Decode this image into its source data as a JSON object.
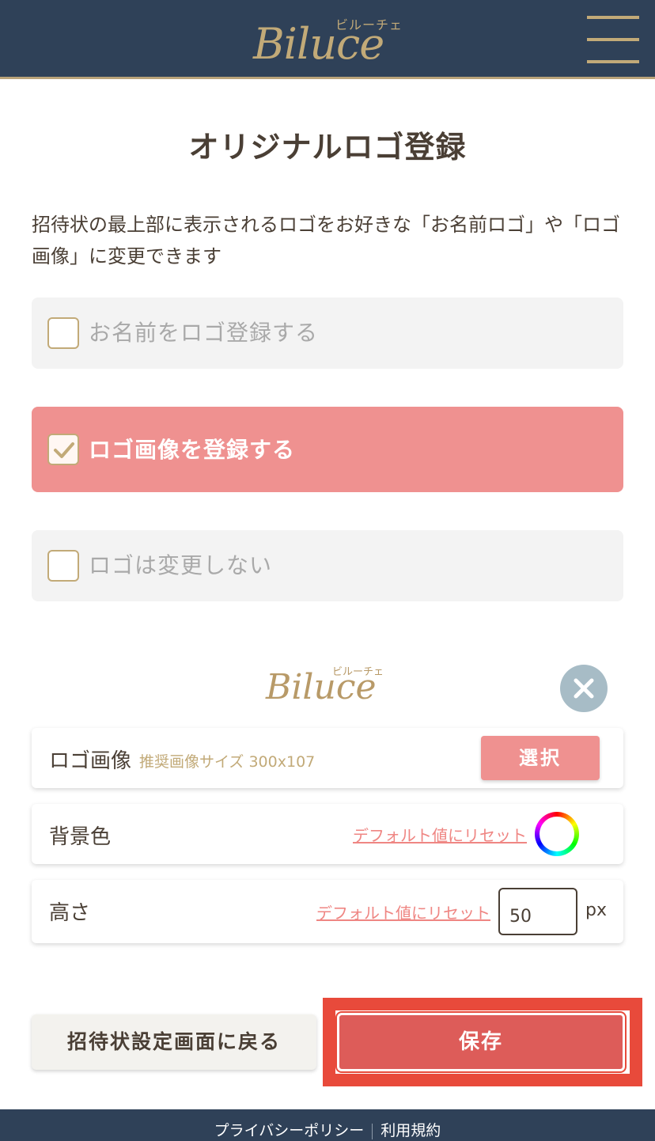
{
  "header": {
    "logo_text": "Biluce",
    "logo_kana": "ビルーチェ"
  },
  "page": {
    "title": "オリジナルロゴ登録",
    "description": "招待状の最上部に表示されるロゴをお好きな「お名前ロゴ」や「ロゴ画像」に変更できます"
  },
  "options": [
    {
      "label": "お名前をロゴ登録する",
      "checked": false
    },
    {
      "label": "ロゴ画像を登録する",
      "checked": true
    },
    {
      "label": "ロゴは変更しない",
      "checked": false
    }
  ],
  "preview": {
    "logo_text": "Biluce",
    "logo_kana": "ビルーチェ"
  },
  "settings": {
    "logo_image": {
      "title": "ロゴ画像",
      "hint": "推奨画像サイズ 300x107",
      "select_label": "選択"
    },
    "background_color": {
      "title": "背景色",
      "reset_label": "デフォルト値にリセット"
    },
    "height": {
      "title": "高さ",
      "reset_label": "デフォルト値にリセット",
      "value": "50",
      "unit": "px"
    }
  },
  "actions": {
    "back_label": "招待状設定画面に戻る",
    "save_label": "保存"
  },
  "footer": {
    "privacy": "プライバシーポリシー",
    "terms": "利用規約"
  },
  "colors": {
    "header_bg": "#2f4158",
    "gold": "#c2aa78",
    "selected_option": "#ef9190",
    "save_button": "#dd5c59",
    "highlight": "#e84a3b"
  }
}
